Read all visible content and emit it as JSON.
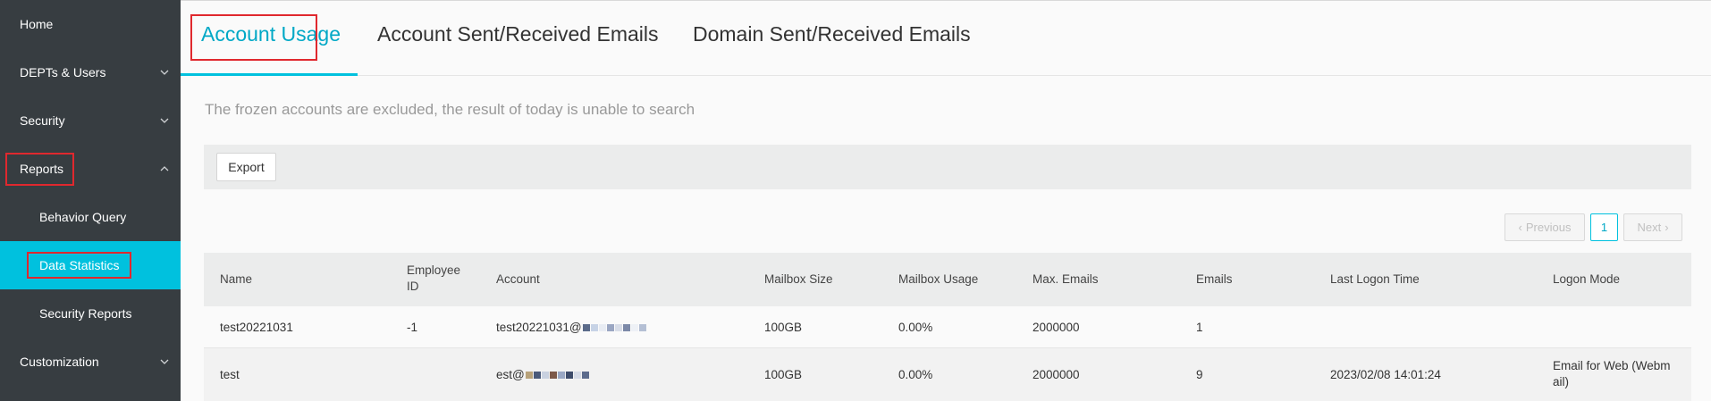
{
  "sidebar": {
    "items": [
      {
        "label": "Home"
      },
      {
        "label": "DEPTs & Users"
      },
      {
        "label": "Security"
      },
      {
        "label": "Reports"
      },
      {
        "label": "Behavior Query"
      },
      {
        "label": "Data Statistics"
      },
      {
        "label": "Security Reports"
      },
      {
        "label": "Customization"
      }
    ]
  },
  "tabs": [
    {
      "label": "Account Usage"
    },
    {
      "label": "Account Sent/Received Emails"
    },
    {
      "label": "Domain Sent/Received Emails"
    }
  ],
  "note": "The frozen accounts are excluded, the result of today is unable to search",
  "toolbar": {
    "export_label": "Export"
  },
  "pager": {
    "previous": "Previous",
    "page": "1",
    "next": "Next"
  },
  "table": {
    "headers": {
      "name": "Name",
      "employee_id_1": "Employee",
      "employee_id_2": "ID",
      "account": "Account",
      "mailbox_size": "Mailbox Size",
      "mailbox_usage": "Mailbox Usage",
      "max_emails": "Max. Emails",
      "emails": "Emails",
      "last_logon": "Last Logon Time",
      "logon_mode": "Logon Mode"
    },
    "rows": [
      {
        "name": "test20221031",
        "employee_id": "-1",
        "account": "test20221031@",
        "mailbox_size": "100GB",
        "mailbox_usage": "0.00%",
        "max_emails": "2000000",
        "emails": "1",
        "last_logon": "",
        "logon_mode_1": "",
        "logon_mode_2": ""
      },
      {
        "name": "test",
        "employee_id": "",
        "account": "est@",
        "mailbox_size": "100GB",
        "mailbox_usage": "0.00%",
        "max_emails": "2000000",
        "emails": "9",
        "last_logon": "2023/02/08 14:01:24",
        "logon_mode_1": "Email for Web (Webm",
        "logon_mode_2": "ail)"
      }
    ]
  },
  "colors": {
    "sidebar_bg": "#373d41",
    "accent": "#00c1de",
    "highlight_outline": "#e0282e"
  }
}
